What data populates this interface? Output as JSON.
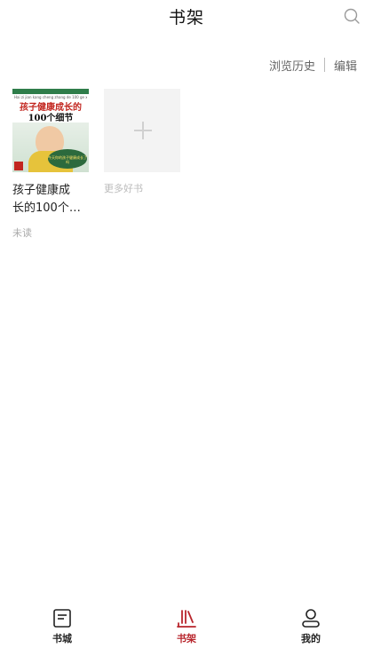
{
  "header": {
    "title": "书架",
    "search_icon": "search-icon"
  },
  "toolbar": {
    "history_label": "浏览历史",
    "edit_label": "编辑"
  },
  "shelf": {
    "books": [
      {
        "cover": {
          "subtitle": "Hai zi jian kang cheng zhang de 100 ge xi jie",
          "title_line1": "孩子健康成长的",
          "title_line2": "100个细节",
          "badge": "今天你的孩子健康成长了吗"
        },
        "title_line1": "孩子健康成",
        "title_line2": "长的100个…",
        "status": "未读"
      }
    ],
    "add_more_label": "更多好书"
  },
  "tabbar": {
    "active_index": 1,
    "active_color": "#b8252c",
    "items": [
      {
        "label": "书城",
        "icon": "bookstore-icon"
      },
      {
        "label": "书架",
        "icon": "bookshelf-icon"
      },
      {
        "label": "我的",
        "icon": "profile-icon"
      }
    ]
  }
}
